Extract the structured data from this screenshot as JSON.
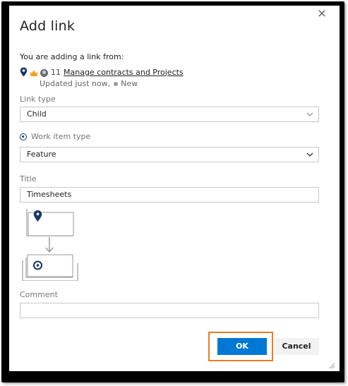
{
  "dialog": {
    "title": "Add link",
    "close_symbol": "×"
  },
  "source": {
    "label": "You are adding a link from:",
    "icons": [
      "map-pin-icon",
      "crown-icon",
      "avatar-icon"
    ],
    "work_item_id": "11",
    "work_item_title": "Manage contracts and Projects",
    "updated_text": "Updated just now,",
    "state": "New"
  },
  "link_type": {
    "label": "Link type",
    "value": "Child"
  },
  "work_item_type": {
    "label": "Work item type",
    "value": "Feature"
  },
  "title_field": {
    "label": "Title",
    "value": "Timesheets"
  },
  "comment_field": {
    "label": "Comment",
    "value": ""
  },
  "buttons": {
    "ok": "OK",
    "cancel": "Cancel"
  },
  "colors": {
    "accent": "#0078d4",
    "highlight": "#e67e22",
    "pin": "#173a67",
    "crown": "#f0a01c"
  }
}
